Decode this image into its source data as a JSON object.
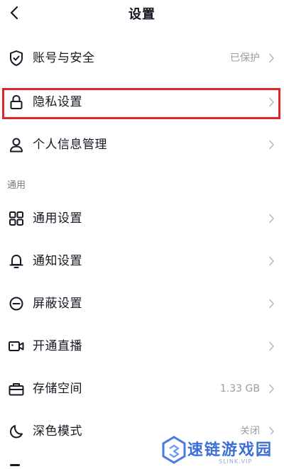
{
  "header": {
    "title": "设置"
  },
  "account_section": {
    "items": [
      {
        "icon": "shield-check-icon",
        "label": "账号与安全",
        "value": "已保护"
      },
      {
        "icon": "lock-icon",
        "label": "隐私设置",
        "value": ""
      },
      {
        "icon": "person-icon",
        "label": "个人信息管理",
        "value": ""
      }
    ]
  },
  "general_section": {
    "title": "通用",
    "items": [
      {
        "icon": "grid-icon",
        "label": "通用设置",
        "value": ""
      },
      {
        "icon": "bell-icon",
        "label": "通知设置",
        "value": ""
      },
      {
        "icon": "block-icon",
        "label": "屏蔽设置",
        "value": ""
      },
      {
        "icon": "video-camera-icon",
        "label": "开通直播",
        "value": ""
      },
      {
        "icon": "storage-box-icon",
        "label": "存储空间",
        "value": "1.33 GB"
      },
      {
        "icon": "moon-icon",
        "label": "深色模式",
        "value": "关闭"
      }
    ]
  },
  "highlight_color": "#e0252b",
  "watermark": {
    "text": "速链游戏园",
    "subtext": "SLINK.VIP"
  }
}
